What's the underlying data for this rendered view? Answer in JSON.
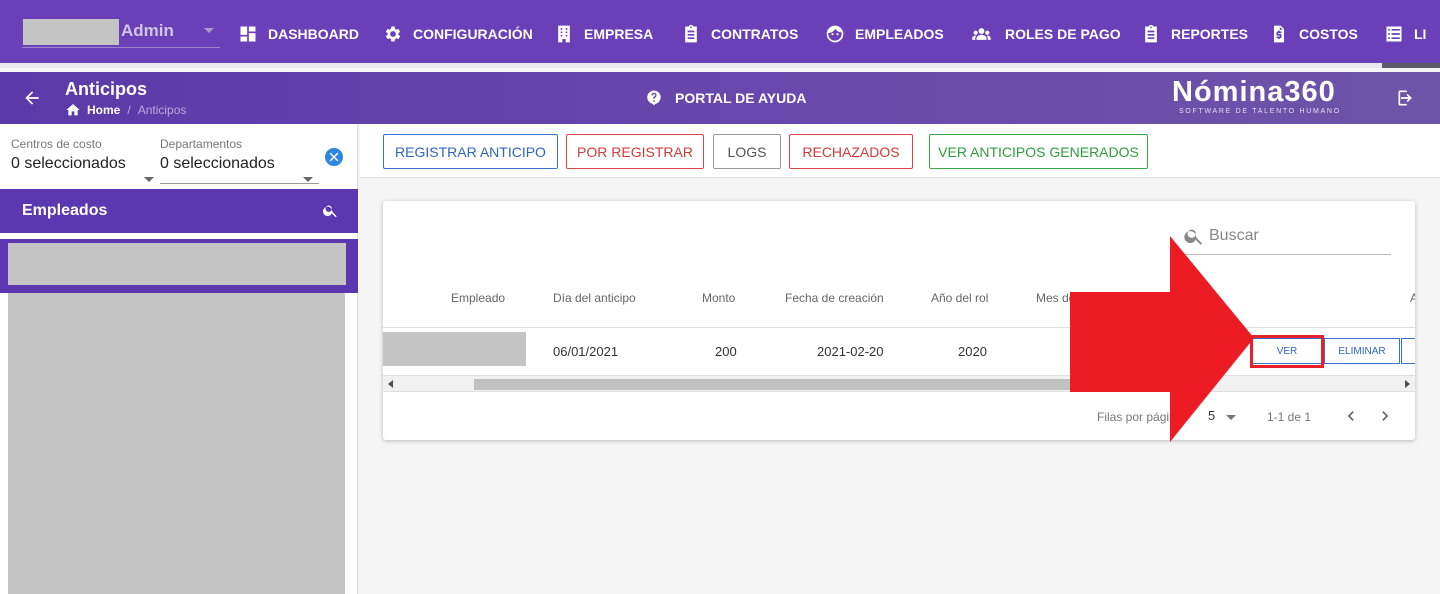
{
  "topnav": {
    "user_name": "Admin",
    "items": [
      {
        "label": "DASHBOARD"
      },
      {
        "label": "CONFIGURACIÓN"
      },
      {
        "label": "EMPRESA"
      },
      {
        "label": "CONTRATOS"
      },
      {
        "label": "EMPLEADOS"
      },
      {
        "label": "ROLES DE PAGO"
      },
      {
        "label": "REPORTES"
      },
      {
        "label": "COSTOS"
      },
      {
        "label": "LI"
      }
    ]
  },
  "subheader": {
    "title": "Anticipos",
    "breadcrumb": {
      "home": "Home",
      "separator": "/",
      "current": "Anticipos"
    },
    "help_label": "PORTAL DE AYUDA",
    "logo_main": "Nómina360",
    "logo_sub": "SOFTWARE DE TALENTO HUMANO"
  },
  "sidebar": {
    "filters": [
      {
        "label": "Centros de costo",
        "value": "0 seleccionados"
      },
      {
        "label": "Departamentos",
        "value": "0 seleccionados"
      }
    ],
    "employees_title": "Empleados"
  },
  "actions": {
    "register": "REGISTRAR ANTICIPO",
    "pending": "POR REGISTRAR",
    "logs": "LOGS",
    "rejected": "RECHAZADOS",
    "generated": "VER ANTICIPOS GENERADOS"
  },
  "table": {
    "search_placeholder": "Buscar",
    "columns": [
      "Empleado",
      "Día del anticipo",
      "Monto",
      "Fecha de creación",
      "Año del rol",
      "Mes de",
      "A"
    ],
    "rows": [
      {
        "day": "06/01/2021",
        "amount": "200",
        "created": "2021-02-20",
        "year": "2020",
        "view_label": "VER",
        "delete_label": "ELIMINAR"
      }
    ],
    "pager": {
      "rows_per_page_label": "Filas por págin",
      "rows_per_page": "5",
      "range": "1-1 de 1"
    }
  },
  "colors": {
    "nav_bg": "#6a3fb8",
    "sidebar_header": "#5b38b0",
    "primary_blue": "#2f64c0",
    "danger_red": "#d43a3a",
    "success_green": "#2e9e3c",
    "annotation_red": "#e8202a"
  },
  "progress": {
    "nav_scroll_fraction": 0.96
  }
}
